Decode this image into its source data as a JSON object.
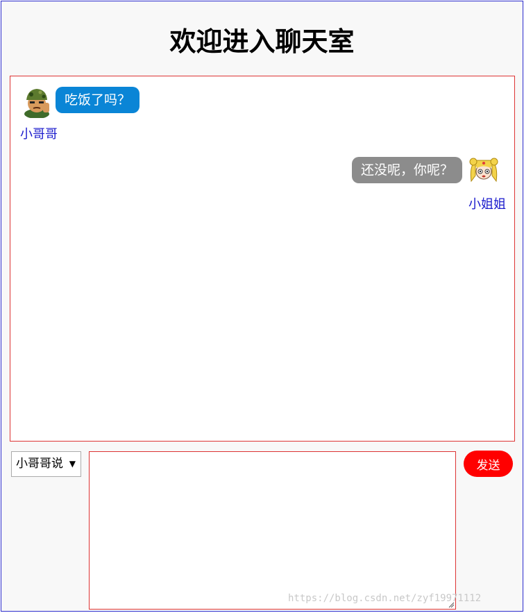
{
  "page": {
    "title": "欢迎进入聊天室"
  },
  "messages": [
    {
      "sender": "小哥哥",
      "text": "吃饭了吗？",
      "side": "left",
      "bubble_color": "#0a85d6",
      "avatar_icon": "soldier-avatar-icon"
    },
    {
      "sender": "小姐姐",
      "text": "还没呢，你呢？",
      "side": "right",
      "bubble_color": "#8c8c8c",
      "avatar_icon": "sailor-girl-avatar-icon"
    }
  ],
  "composer": {
    "speaker_selected": "小哥哥说",
    "input_value": "",
    "send_label": "发送"
  },
  "watermark": "https://blog.csdn.net/zyf19971112",
  "colors": {
    "frame_border": "#2b2bcc",
    "chat_border": "#dd3333",
    "sender_name": "#1a1acc",
    "send_button": "#ff0000"
  }
}
